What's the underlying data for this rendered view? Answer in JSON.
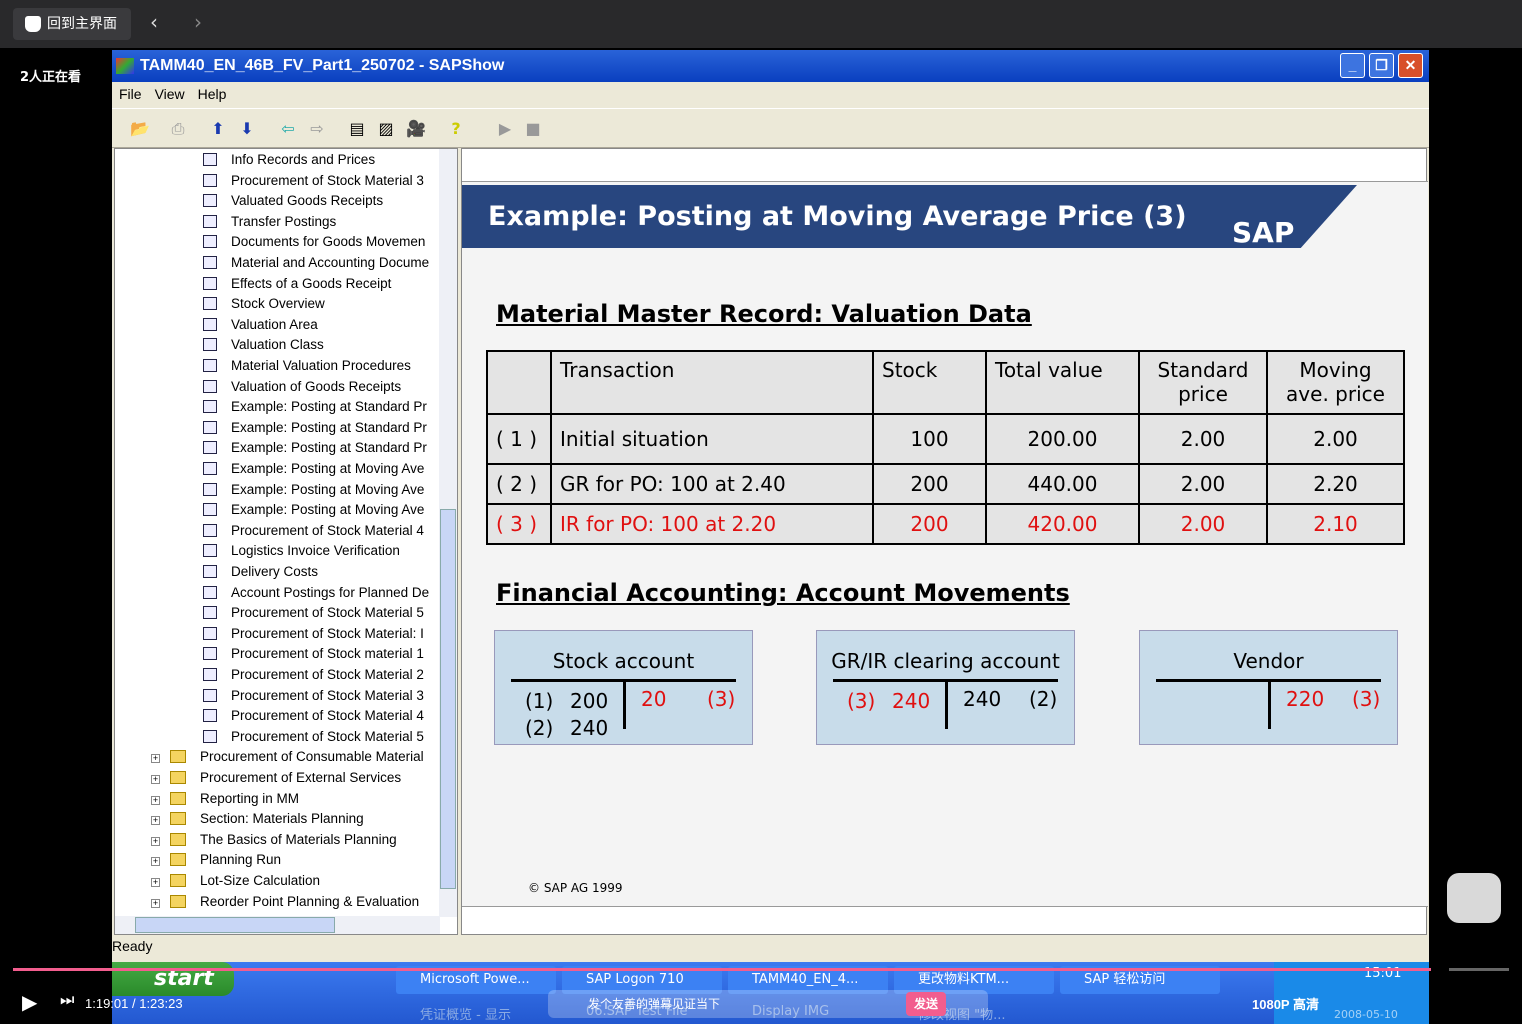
{
  "player": {
    "home_label": "回到主界面",
    "viewers": "2人正在看",
    "time": "1:19:01 / 1:23:23",
    "quality": "1080P 高清",
    "danmu_placeholder": "发个友善的弹幕见证当下",
    "send_label": "发送",
    "progress_percent": 94.8
  },
  "window": {
    "title": "TAMM40_EN_46B_FV_Part1_250702 - SAPShow",
    "menu": [
      "File",
      "View",
      "Help"
    ],
    "status": "Ready"
  },
  "tree": {
    "items": [
      {
        "t": "Info Records and Prices",
        "k": "doc"
      },
      {
        "t": "Procurement of Stock Material 3",
        "k": "doc"
      },
      {
        "t": "Valuated Goods Receipts",
        "k": "doc"
      },
      {
        "t": "Transfer Postings",
        "k": "doc"
      },
      {
        "t": "Documents for Goods Movemen",
        "k": "doc"
      },
      {
        "t": "Material and Accounting Docume",
        "k": "doc"
      },
      {
        "t": "Effects of a Goods Receipt",
        "k": "doc"
      },
      {
        "t": "Stock Overview",
        "k": "doc"
      },
      {
        "t": "Valuation Area",
        "k": "doc"
      },
      {
        "t": "Valuation Class",
        "k": "doc"
      },
      {
        "t": "Material Valuation Procedures",
        "k": "doc"
      },
      {
        "t": "Valuation of Goods Receipts",
        "k": "doc"
      },
      {
        "t": "Example: Posting at Standard Pr",
        "k": "doc"
      },
      {
        "t": "Example: Posting at Standard Pr",
        "k": "doc"
      },
      {
        "t": "Example: Posting at Standard Pr",
        "k": "doc"
      },
      {
        "t": "Example: Posting at Moving Ave",
        "k": "doc"
      },
      {
        "t": "Example: Posting at Moving Ave",
        "k": "doc"
      },
      {
        "t": "Example: Posting at Moving Ave",
        "k": "doc"
      },
      {
        "t": "Procurement of Stock Material 4",
        "k": "doc"
      },
      {
        "t": "Logistics Invoice Verification",
        "k": "doc"
      },
      {
        "t": "Delivery Costs",
        "k": "doc"
      },
      {
        "t": "Account Postings for Planned De",
        "k": "doc"
      },
      {
        "t": "Procurement of Stock Material 5",
        "k": "doc"
      },
      {
        "t": "Procurement of Stock Material: I",
        "k": "doc"
      },
      {
        "t": "Procurement of Stock material 1",
        "k": "doc"
      },
      {
        "t": "Procurement of Stock Material 2",
        "k": "doc"
      },
      {
        "t": "Procurement of Stock Material 3",
        "k": "doc"
      },
      {
        "t": "Procurement of Stock Material 4",
        "k": "doc"
      },
      {
        "t": "Procurement of Stock Material 5",
        "k": "doc"
      },
      {
        "t": "Procurement of Consumable Material",
        "k": "folder"
      },
      {
        "t": "Procurement of External Services",
        "k": "folder"
      },
      {
        "t": "Reporting in MM",
        "k": "folder"
      },
      {
        "t": "Section: Materials Planning",
        "k": "folder"
      },
      {
        "t": "The Basics of Materials Planning",
        "k": "folder"
      },
      {
        "t": "Planning Run",
        "k": "folder"
      },
      {
        "t": "Lot-Size Calculation",
        "k": "folder"
      },
      {
        "t": "Reorder Point Planning & Evaluation",
        "k": "folder"
      }
    ]
  },
  "slide": {
    "title": "Example: Posting at Moving Average Price (3)",
    "logo": "SAP",
    "section1": "Material Master Record: Valuation Data",
    "section2": "Financial Accounting: Account Movements",
    "copyright": "© SAP AG 1999",
    "table": {
      "headers": [
        "",
        "Transaction",
        "Stock",
        "Total value",
        "Standard price",
        "Moving ave. price"
      ],
      "rows": [
        [
          "( 1 )",
          "Initial situation",
          "100",
          "200.00",
          "2.00",
          "2.00"
        ],
        [
          "( 2 )",
          "GR for PO: 100 at 2.40",
          "200",
          "440.00",
          "2.00",
          "2.20"
        ],
        [
          "( 3 )",
          "IR for PO: 100 at 2.20",
          "200",
          "420.00",
          "2.00",
          "2.10"
        ]
      ]
    },
    "accounts": [
      {
        "name": "Stock account",
        "debit": [
          [
            "(1)",
            "200"
          ],
          [
            "(2)",
            "240"
          ]
        ],
        "credit": [
          [
            "20",
            "(3)"
          ]
        ]
      },
      {
        "name": "GR/IR clearing account",
        "debit": [
          [
            "(3)",
            "240"
          ]
        ],
        "credit": [
          [
            "240",
            "(2)"
          ]
        ]
      },
      {
        "name": "Vendor",
        "debit": [],
        "credit": [
          [
            "220",
            "(3)"
          ]
        ]
      }
    ],
    "highlight_color": "#e01010"
  },
  "taskbar": {
    "start": "start",
    "tasks": [
      "Microsoft Powe...",
      "SAP Logon 710",
      "TAMM40_EN_4...",
      "更改物料KTM...",
      "SAP 轻松访问"
    ],
    "tasks_row2": [
      "凭证概览 - 显示",
      "06.SAP Test File",
      "Display IMG",
      "修改视图 \"物..."
    ],
    "clock": "15:01",
    "date": "2008-05-10"
  }
}
